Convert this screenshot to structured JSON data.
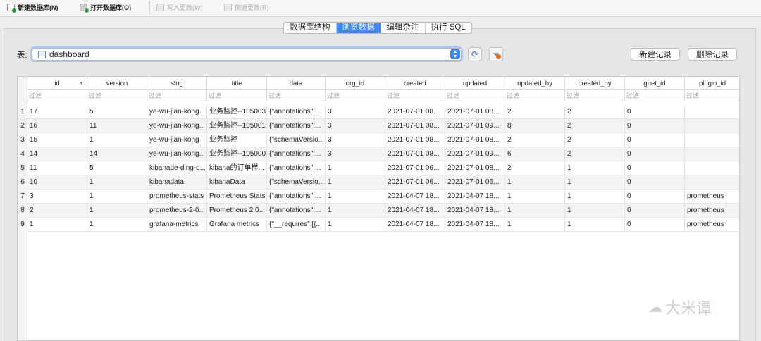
{
  "toolbar": {
    "new_db": "新建数据库(N)",
    "open_db": "打开数据库(O)",
    "write_changes": "写入更改(W)",
    "revert_changes": "倒退更改(R)"
  },
  "tabs": [
    "数据库结构",
    "浏览数据",
    "编辑杂注",
    "执行 SQL"
  ],
  "active_tab": 1,
  "table_picker": {
    "label": "表:",
    "value": "dashboard"
  },
  "buttons": {
    "new_record": "新建记录",
    "delete_record": "删除记录"
  },
  "filter_placeholder": "过滤",
  "columns": [
    "id",
    "version",
    "slug",
    "title",
    "data",
    "org_id",
    "created",
    "updated",
    "updated_by",
    "created_by",
    "gnet_id",
    "plugin_id"
  ],
  "rows": [
    {
      "n": "1",
      "cells": [
        "17",
        "5",
        "ye-wu-jian-kong...",
        "业务监控--105003",
        "{\"annotations\":...",
        "3",
        "2021-07-01 08...",
        "2021-07-01 08...",
        "2",
        "2",
        "0",
        ""
      ]
    },
    {
      "n": "2",
      "cells": [
        "16",
        "11",
        "ye-wu-jian-kong...",
        "业务监控--105001",
        "{\"annotations\":...",
        "3",
        "2021-07-01 08...",
        "2021-07-01 09...",
        "8",
        "2",
        "0",
        ""
      ]
    },
    {
      "n": "3",
      "cells": [
        "15",
        "1",
        "ye-wu-jian-kong",
        "业务监控",
        "{\"schemaVersio...",
        "3",
        "2021-07-01 08...",
        "2021-07-01 08...",
        "2",
        "2",
        "0",
        ""
      ]
    },
    {
      "n": "4",
      "cells": [
        "14",
        "14",
        "ye-wu-jian-kong...",
        "业务监控--105000",
        "{\"annotations\":...",
        "3",
        "2021-07-01 08...",
        "2021-07-01 09...",
        "6",
        "2",
        "0",
        ""
      ]
    },
    {
      "n": "5",
      "cells": [
        "11",
        "5",
        "kibanade-ding-d...",
        "kibana的订单样...",
        "{\"annotations\":...",
        "1",
        "2021-07-01 06...",
        "2021-07-01 08...",
        "2",
        "1",
        "0",
        ""
      ]
    },
    {
      "n": "6",
      "cells": [
        "10",
        "1",
        "kibanadata",
        "kibanaData",
        "{\"schemaVersio...",
        "1",
        "2021-07-01 06...",
        "2021-07-01 06...",
        "1",
        "1",
        "0",
        ""
      ]
    },
    {
      "n": "7",
      "cells": [
        "3",
        "1",
        "prometheus-stats",
        "Prometheus Stats",
        "{\"annotations\":...",
        "1",
        "2021-04-07 18...",
        "2021-04-07 18...",
        "1",
        "1",
        "0",
        "prometheus"
      ]
    },
    {
      "n": "8",
      "cells": [
        "2",
        "1",
        "prometheus-2-0...",
        "Prometheus 2.0...",
        "{\"annotations\":...",
        "1",
        "2021-04-07 18...",
        "2021-04-07 18...",
        "1",
        "1",
        "0",
        "prometheus"
      ]
    },
    {
      "n": "9",
      "cells": [
        "1",
        "1",
        "grafana-metrics",
        "Grafana metrics",
        "{\"__requires\":[{...",
        "1",
        "2021-04-07 18...",
        "2021-04-07 18...",
        "1",
        "1",
        "0",
        "prometheus"
      ]
    }
  ],
  "watermark": "大米谭",
  "icons": {
    "new_db": "new-database-icon",
    "open_db": "open-database-icon",
    "write": "write-changes-icon",
    "revert": "revert-changes-icon",
    "table": "table-icon",
    "refresh": "refresh-icon",
    "filter": "clear-filter-icon",
    "sort": "sort-desc-icon"
  },
  "colors": {
    "accent": "#3e87f5"
  }
}
